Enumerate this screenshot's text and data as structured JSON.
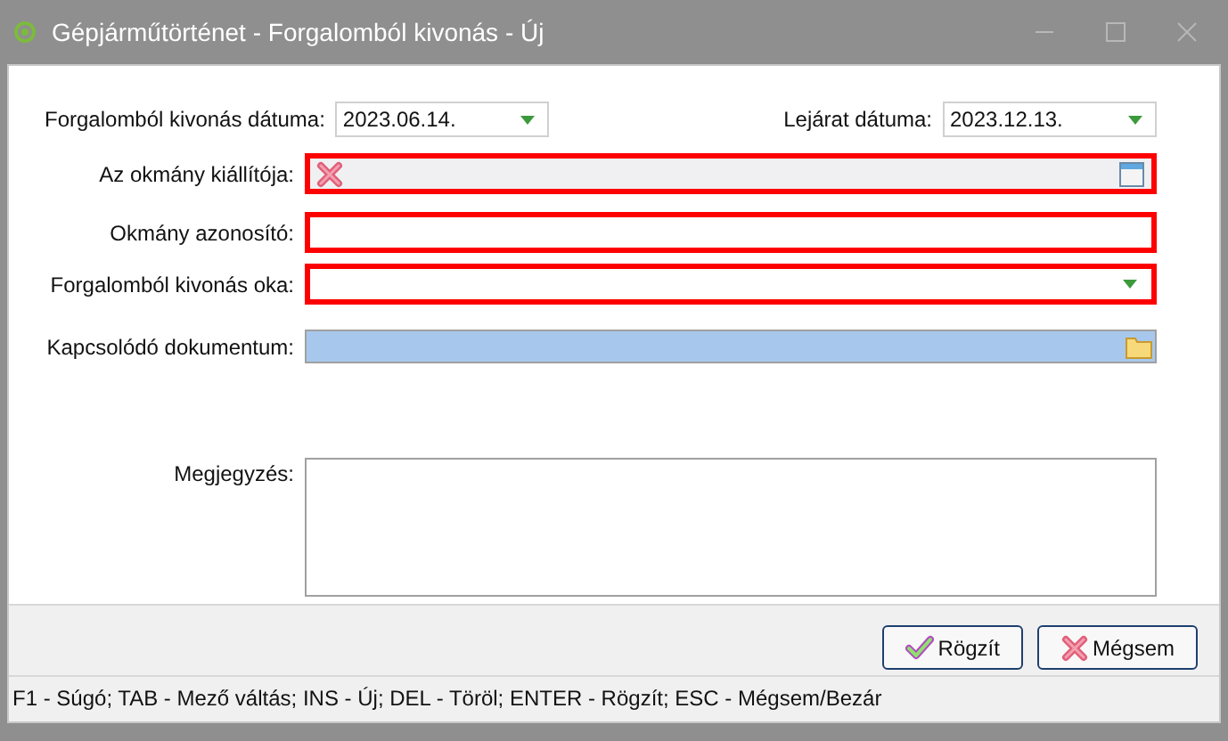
{
  "window": {
    "title": "Gépjárműtörténet - Forgalomból kivonás - Új"
  },
  "dates": [
    {
      "label": "Forgalomból kivonás dátuma:",
      "value": "2023.06.14."
    },
    {
      "label": "Lejárat dátuma:",
      "value": "2023.12.13."
    }
  ],
  "fields": [
    {
      "kind": "lookup",
      "label": "Az okmány kiállítója:",
      "required": true
    },
    {
      "kind": "text",
      "label": "Okmány azonosító:",
      "required": true
    },
    {
      "kind": "combo",
      "label": "Forgalomból kivonás oka:",
      "required": true
    },
    {
      "kind": "file",
      "label": "Kapcsolódó dokumentum:",
      "required": false
    },
    {
      "kind": "memo",
      "label": "Megjegyzés:",
      "required": false
    }
  ],
  "buttons": [
    {
      "kind": "save",
      "label": "Rögzít"
    },
    {
      "kind": "cancel",
      "label": "Mégsem"
    }
  ],
  "status_bar": "F1 - Súgó; TAB - Mező váltás; INS - Új; DEL - Töröl; ENTER - Rögzít; ESC - Mégsem/Bezár"
}
